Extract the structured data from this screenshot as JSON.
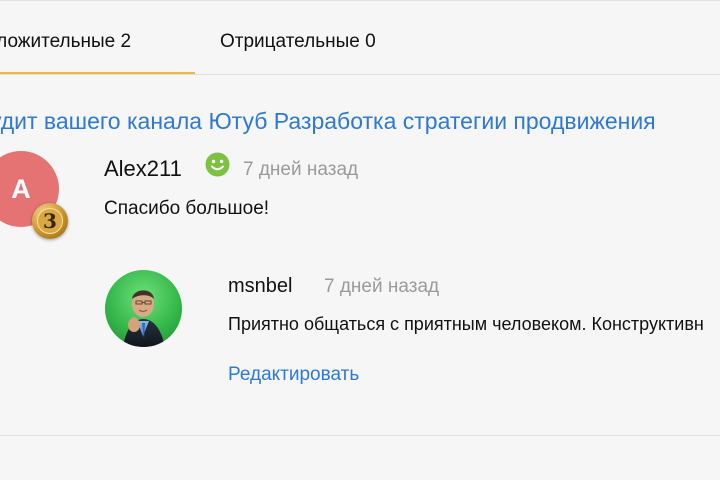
{
  "tabs": {
    "positive": "оложительные 2",
    "negative": "Отрицательные 0"
  },
  "review": {
    "service_title": "удит вашего канала Ютуб Разработка стратегии продвижения",
    "author": {
      "avatar_letter": "A",
      "level": "3",
      "name": "Alex211",
      "status_icon": "smile-icon",
      "time": "7 дней назад"
    },
    "text": "Спасибо большое!"
  },
  "reply": {
    "author_name": "msnbel",
    "time": "7 дней назад",
    "text": "Приятно общаться с приятным человеком. Конструктивн",
    "edit_label": "Редактировать"
  },
  "colors": {
    "accent": "#f4b63d",
    "link": "#2e79d4",
    "avatar": "#e57373",
    "muted": "#9a9a9a",
    "positive_icon": "#7cc142"
  }
}
